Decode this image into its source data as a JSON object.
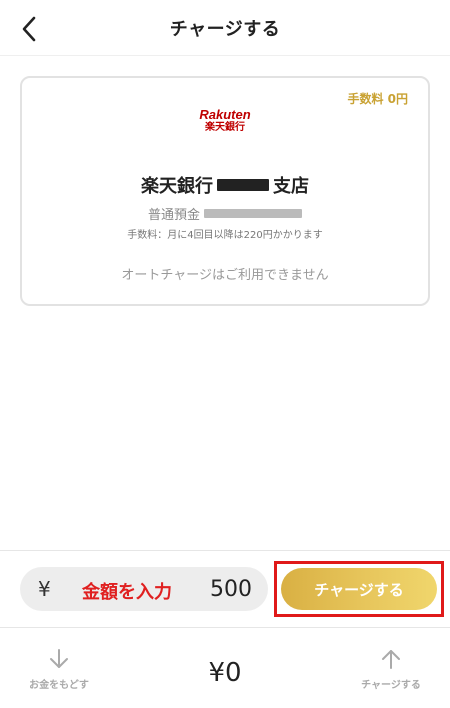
{
  "header": {
    "title": "チャージする",
    "back_icon": "chevron-left-icon"
  },
  "bank_card": {
    "fee_tag": "手数料 0円",
    "logo_en": "Rakuten",
    "logo_ja": "楽天銀行",
    "bank_name": "楽天銀行",
    "branch_suffix": "支店",
    "account_type": "普通預金",
    "fee_note": "手数料：月に4回目以降は220円かかります",
    "auto_charge_note": "オートチャージはご利用できません"
  },
  "amount_input": {
    "currency": "¥",
    "hint": "金額を入力",
    "value": "500"
  },
  "charge_button": {
    "label": "チャージする"
  },
  "bottom_bar": {
    "return_label": "お金をもどす",
    "balance": "¥0",
    "charge_label": "チャージする"
  },
  "colors": {
    "accent_gold": "#d9b043",
    "highlight_red": "#e01919",
    "rakuten_red": "#bf0000"
  }
}
